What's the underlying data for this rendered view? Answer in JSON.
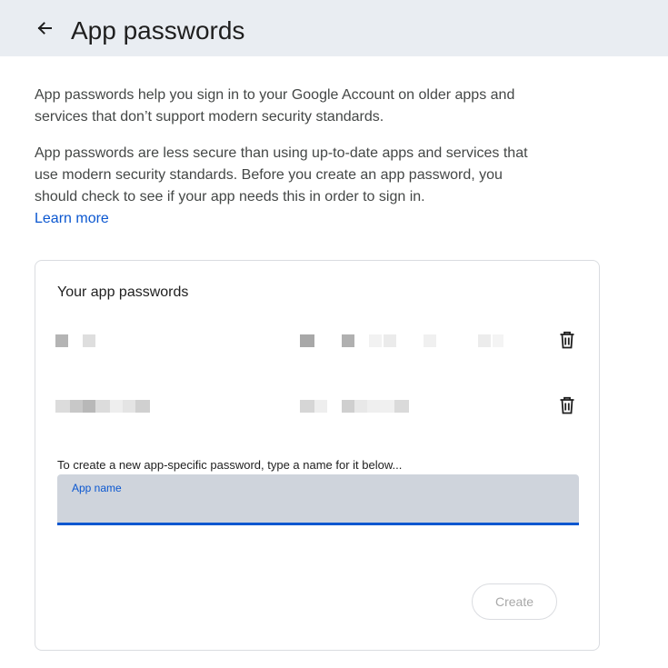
{
  "header": {
    "title": "App passwords",
    "back_icon": "arrow-left-icon",
    "background": "#e9edf2"
  },
  "intro": {
    "paragraph1": "App passwords help you sign in to your Google Account on older apps and services that don’t support modern security standards.",
    "paragraph2": "App passwords are less secure than using up-to-date apps and services that use modern security standards. Before you create an app password, you should check to see if your app needs this in order to sign in.",
    "learn_more": "Learn more",
    "link_color": "#0b57d0"
  },
  "card": {
    "title": "Your app passwords",
    "passwords": [
      {
        "name_redacted": true,
        "created_redacted": true,
        "delete_icon": "trash-icon"
      },
      {
        "name_redacted": true,
        "created_redacted": true,
        "delete_icon": "trash-icon"
      }
    ],
    "hint": "To create a new app-specific password, type a name for it below...",
    "field": {
      "label": "App name",
      "value": "",
      "accent": "#0b57d0"
    },
    "create_button": "Create",
    "create_disabled": true
  }
}
